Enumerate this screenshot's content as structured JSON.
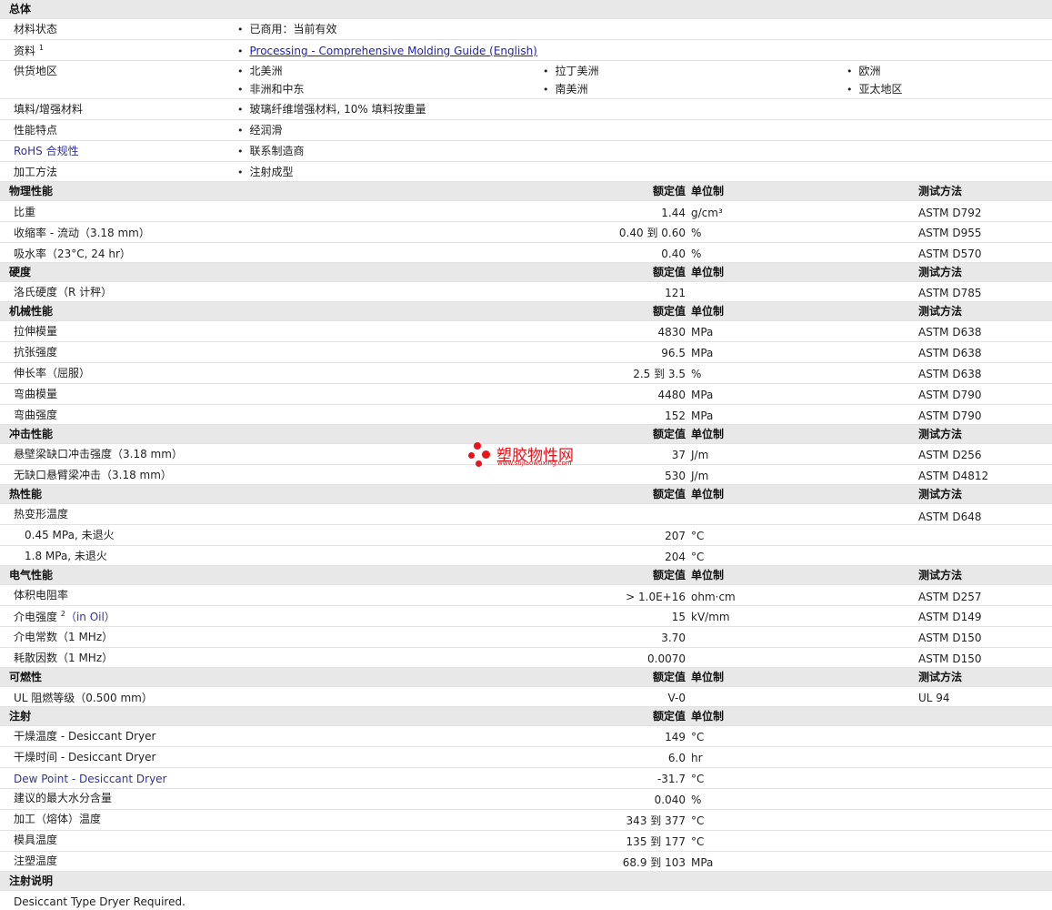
{
  "general": {
    "title": "总体",
    "material_status": {
      "label": "材料状态",
      "value": "已商用：当前有效"
    },
    "literature": {
      "label": "资料",
      "sup": "1",
      "link": "Processing - Comprehensive Molding Guide (English)"
    },
    "regions": {
      "label": "供货地区",
      "items": [
        "北美洲",
        "拉丁美洲",
        "欧洲",
        "非洲和中东",
        "南美洲",
        "亚太地区"
      ]
    },
    "filler": {
      "label": "填料/增强材料",
      "value": "玻璃纤维增强材料, 10% 填料按重量"
    },
    "features": {
      "label": "性能特点",
      "value": "经润滑"
    },
    "rohs": {
      "label": "RoHS 合规性",
      "value": "联系制造商"
    },
    "processing": {
      "label": "加工方法",
      "value": "注射成型"
    }
  },
  "headers": {
    "nominal": "额定值",
    "unit": "单位制",
    "test": "测试方法"
  },
  "physical": {
    "title": "物理性能",
    "rows": [
      {
        "label": "比重",
        "value": "1.44",
        "unit": "g/cm³",
        "test": "ASTM D792"
      },
      {
        "label": "收缩率 - 流动（3.18 mm）",
        "value": "0.40 到 0.60",
        "unit": "%",
        "test": "ASTM D955"
      },
      {
        "label": "吸水率（23°C, 24 hr）",
        "value": "0.40",
        "unit": "%",
        "test": "ASTM D570"
      }
    ]
  },
  "hardness": {
    "title": "硬度",
    "rows": [
      {
        "label": "洛氏硬度（R 计秤）",
        "value": "121",
        "unit": "",
        "test": "ASTM D785"
      }
    ]
  },
  "mechanical": {
    "title": "机械性能",
    "rows": [
      {
        "label": "拉伸模量",
        "value": "4830",
        "unit": "MPa",
        "test": "ASTM D638"
      },
      {
        "label": "抗张强度",
        "value": "96.5",
        "unit": "MPa",
        "test": "ASTM D638"
      },
      {
        "label": "伸长率（屈服）",
        "value": "2.5 到 3.5",
        "unit": "%",
        "test": "ASTM D638"
      },
      {
        "label": "弯曲模量",
        "value": "4480",
        "unit": "MPa",
        "test": "ASTM D790"
      },
      {
        "label": "弯曲强度",
        "value": "152",
        "unit": "MPa",
        "test": "ASTM D790"
      }
    ]
  },
  "impact": {
    "title": "冲击性能",
    "rows": [
      {
        "label": "悬壁梁缺口冲击强度（3.18 mm）",
        "value": "37",
        "unit": "J/m",
        "test": "ASTM D256"
      },
      {
        "label": "无缺口悬臂梁冲击（3.18 mm）",
        "value": "530",
        "unit": "J/m",
        "test": "ASTM D4812"
      }
    ]
  },
  "thermal": {
    "title": "热性能",
    "rows": [
      {
        "label": "热变形温度",
        "value": "",
        "unit": "",
        "test": "ASTM D648"
      },
      {
        "label": "0.45 MPa, 未退火",
        "value": "207",
        "unit": "°C",
        "test": ""
      },
      {
        "label": "1.8 MPa, 未退火",
        "value": "204",
        "unit": "°C",
        "test": ""
      }
    ]
  },
  "electrical": {
    "title": "电气性能",
    "rows": [
      {
        "label": "体积电阻率",
        "value": "> 1.0E+16",
        "unit": "ohm·cm",
        "test": "ASTM D257"
      },
      {
        "label": "介电强度",
        "sup": "2",
        "suffix": "（in Oil）",
        "value": "15",
        "unit": "kV/mm",
        "test": "ASTM D149"
      },
      {
        "label": "介电常数（1 MHz）",
        "value": "3.70",
        "unit": "",
        "test": "ASTM D150"
      },
      {
        "label": "耗散因数（1 MHz）",
        "value": "0.0070",
        "unit": "",
        "test": "ASTM D150"
      }
    ]
  },
  "flammability": {
    "title": "可燃性",
    "rows": [
      {
        "label": "UL 阻燃等级（0.500 mm）",
        "value": "V-0",
        "unit": "",
        "test": "UL 94"
      }
    ]
  },
  "injection": {
    "title": "注射",
    "rows": [
      {
        "label": "干燥温度 - Desiccant Dryer",
        "value": "149",
        "unit": "°C"
      },
      {
        "label": "干燥时间 - Desiccant Dryer",
        "value": "6.0",
        "unit": "hr"
      },
      {
        "label": "Dew Point - Desiccant Dryer",
        "value": "-31.7",
        "unit": "°C"
      },
      {
        "label": "建议的最大水分含量",
        "value": "0.040",
        "unit": "%"
      },
      {
        "label": "加工（熔体）温度",
        "value": "343 到 377",
        "unit": "°C"
      },
      {
        "label": "模具温度",
        "value": "135 到 177",
        "unit": "°C"
      },
      {
        "label": "注塑温度",
        "value": "68.9 到 103",
        "unit": "MPa"
      }
    ]
  },
  "injection_notes": {
    "title": "注射说明",
    "text": "Desiccant Type Dryer Required."
  },
  "watermark": {
    "name": "塑胶物性网",
    "url": "www.sujiaowuxing.com"
  },
  "colors": {
    "section_bg": "#e8e8e8",
    "link": "#2222aa",
    "accent_text": "#333399",
    "watermark": "#e8141b"
  }
}
